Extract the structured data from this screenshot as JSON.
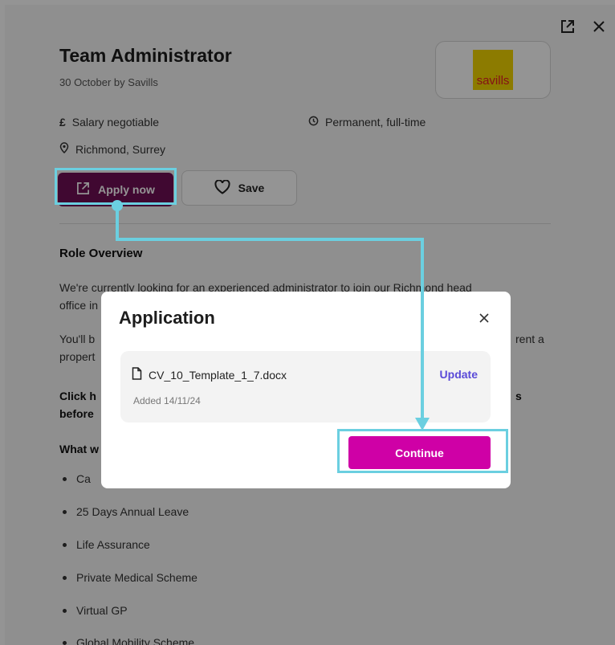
{
  "job": {
    "title": "Team Administrator",
    "subtitle": "30 October by Savills",
    "salary": "Salary negotiable",
    "salary_icon_glyph": "£",
    "contract": "Permanent, full-time",
    "location": "Richmond, Surrey",
    "logo_text": "savills"
  },
  "actions": {
    "apply_label": "Apply now",
    "save_label": "Save"
  },
  "description": {
    "heading": "Role Overview",
    "para1_line1": "We're currently looking for an experienced administrator to join our Richmond head",
    "para1_line2": "office in",
    "para2_line1": "You'll b",
    "para2_line1_right": "rent a",
    "para2_line2": "propert",
    "bold1_line1": "Click h",
    "bold1_line1_right": "s",
    "bold1_line2": "before",
    "bold2": "What w",
    "benefits": [
      "Ca",
      "25 Days Annual Leave",
      "Life Assurance",
      "Private Medical Scheme",
      "Virtual GP",
      "Global Mobility Scheme"
    ]
  },
  "modal": {
    "title": "Application",
    "file_name": "CV_10_Template_1_7.docx",
    "file_added": "Added 14/11/24",
    "update_label": "Update",
    "continue_label": "Continue"
  },
  "colors": {
    "apply_button": "#6e0e55",
    "continue_button": "#cf00a6",
    "highlight": "#6bcfe0",
    "update_link": "#5a4ad8"
  },
  "icons": [
    "open-external-icon",
    "close-icon",
    "pound-icon",
    "clock-icon",
    "location-pin-icon",
    "external-link-icon",
    "heart-icon",
    "document-icon"
  ]
}
